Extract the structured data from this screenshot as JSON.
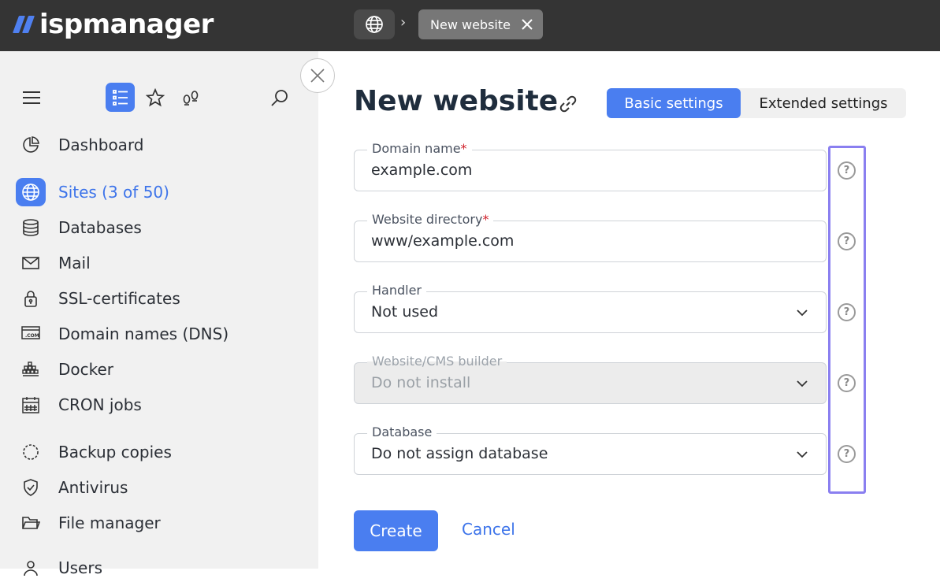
{
  "header": {
    "logo_text": "ispmanager",
    "breadcrumb_home_icon": "globe-icon",
    "breadcrumb_separator": "›",
    "active_tab_label": "New website"
  },
  "sidebar": {
    "tools": [
      "menu-icon",
      "list-icon",
      "star-icon",
      "footprints-icon",
      "search-icon"
    ],
    "items": [
      {
        "label": "Dashboard",
        "icon": "pie-chart-icon"
      },
      {
        "label": "Sites (3 of 50)",
        "icon": "globe-icon",
        "active": true
      },
      {
        "label": "Databases",
        "icon": "database-icon"
      },
      {
        "label": "Mail",
        "icon": "mail-icon"
      },
      {
        "label": "SSL-certificates",
        "icon": "lock-icon"
      },
      {
        "label": "Domain names (DNS)",
        "icon": "dns-icon"
      },
      {
        "label": "Docker",
        "icon": "docker-icon"
      },
      {
        "label": "CRON jobs",
        "icon": "calendar-icon"
      },
      {
        "label": "Backup copies",
        "icon": "backup-icon"
      },
      {
        "label": "Antivirus",
        "icon": "shield-icon"
      },
      {
        "label": "File manager",
        "icon": "folder-icon"
      },
      {
        "label": "Users",
        "icon": "user-icon"
      }
    ]
  },
  "main": {
    "title": "New website",
    "tabs": {
      "basic": "Basic settings",
      "extended": "Extended settings"
    },
    "fields": [
      {
        "label": "Domain name",
        "required": "*",
        "value": "example.com"
      },
      {
        "label": "Website directory",
        "required": "*",
        "value": "www/example.com"
      },
      {
        "label": "Handler",
        "value": "Not used"
      },
      {
        "label": "Website/CMS builder",
        "value": "Do not install"
      },
      {
        "label": "Database",
        "value": "Do not assign database"
      }
    ],
    "help_symbol": "?",
    "create_label": "Create",
    "cancel_label": "Cancel"
  },
  "colors": {
    "accent": "#4a7ef0",
    "topbar": "#343434",
    "sidebar": "#f1f1f1",
    "highlight": "#8a7ff0"
  }
}
